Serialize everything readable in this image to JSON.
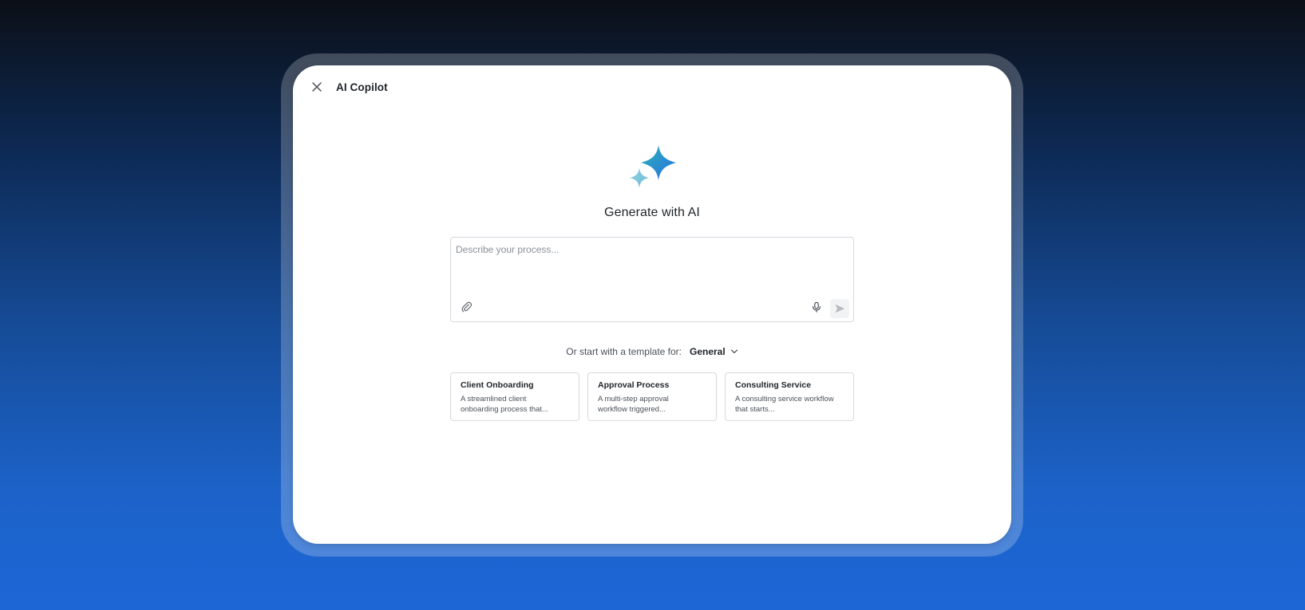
{
  "header": {
    "title": "AI Copilot",
    "close_icon": "close-icon"
  },
  "hero": {
    "icon": "sparkle-icon",
    "title": "Generate with AI"
  },
  "prompt": {
    "placeholder": "Describe your process...",
    "value": "",
    "attach_icon": "paperclip-icon",
    "mic_icon": "microphone-icon",
    "send_icon": "send-icon"
  },
  "templates": {
    "label": "Or start with a template for:",
    "selected": "General",
    "chevron_icon": "chevron-down-icon",
    "cards": [
      {
        "title": "Client Onboarding",
        "desc_line1": "A streamlined client",
        "desc_line2": "onboarding process that..."
      },
      {
        "title": "Approval Process",
        "desc_line1": "A multi-step approval",
        "desc_line2": "workflow triggered..."
      },
      {
        "title": "Consulting Service",
        "desc_line1": "A consulting service workflow",
        "desc_line2": "that starts..."
      }
    ]
  },
  "colors": {
    "sparkle_start": "#8fd0e0",
    "sparkle_mid": "#2bb3b8",
    "sparkle_end": "#2a6fe0",
    "border": "#d6d9de"
  }
}
